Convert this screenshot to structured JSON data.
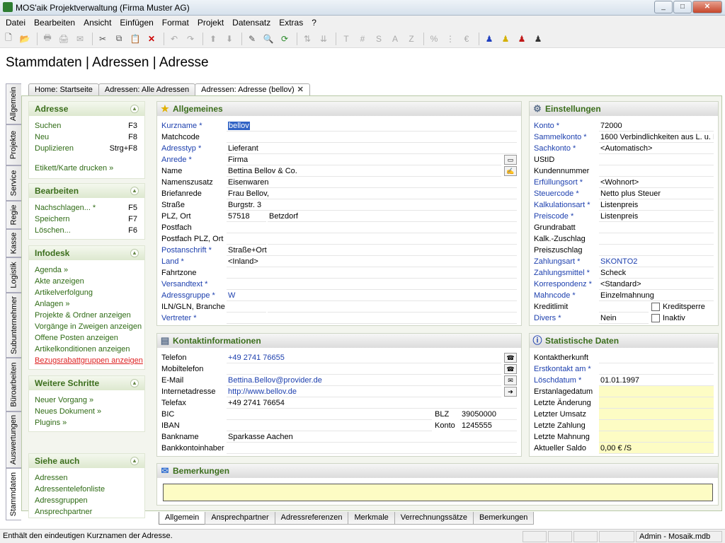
{
  "window": {
    "title": "MOS'aik Projektverwaltung (Firma Muster AG)"
  },
  "menu": [
    "Datei",
    "Bearbeiten",
    "Ansicht",
    "Einfügen",
    "Format",
    "Projekt",
    "Datensatz",
    "Extras",
    "?"
  ],
  "heading": "Stammdaten | Adressen | Adresse",
  "vertical_tabs": [
    "Allgemein",
    "Projekte",
    "Service",
    "Regie",
    "Kasse",
    "Logistik",
    "Subunternehmer",
    "Büroarbeiten",
    "Auswertungen",
    "Stammdaten"
  ],
  "doc_tabs": [
    "Home: Startseite",
    "Adressen: Alle Adressen",
    "Adressen: Adresse (bellov)"
  ],
  "sidebar": {
    "adresse": {
      "title": "Adresse",
      "items": [
        {
          "label": "Suchen",
          "key": "F3"
        },
        {
          "label": "Neu",
          "key": "F8"
        },
        {
          "label": "Duplizieren",
          "key": "Strg+F8"
        }
      ],
      "extra": "Etikett/Karte drucken »"
    },
    "bearbeiten": {
      "title": "Bearbeiten",
      "items": [
        {
          "label": "Nachschlagen... *",
          "key": "F5"
        },
        {
          "label": "Speichern",
          "key": "F7"
        },
        {
          "label": "Löschen...",
          "key": "F6"
        }
      ]
    },
    "infodesk": {
      "title": "Infodesk",
      "items": [
        "Agenda »",
        "Akte anzeigen",
        "Artikelverfolgung",
        "Anlagen »",
        "Projekte & Ordner anzeigen",
        "Vorgänge in Zweigen anzeigen",
        "Offene Posten anzeigen",
        "Artikelkonditionen anzeigen",
        "Bezugsrabattgruppen anzeigen"
      ]
    },
    "weitere": {
      "title": "Weitere Schritte",
      "items": [
        "Neuer Vorgang »",
        "Neues Dokument »",
        "Plugins »"
      ]
    },
    "siehe": {
      "title": "Siehe auch",
      "items": [
        "Adressen",
        "Adressentelefonliste",
        "Adressgruppen",
        "Ansprechpartner"
      ]
    }
  },
  "allgemeines": {
    "title": "Allgemeines",
    "rows": [
      {
        "label": "Kurzname *",
        "value": "bellov"
      },
      {
        "label": "Matchcode",
        "value": ""
      },
      {
        "label": "Adresstyp *",
        "value": "Lieferant"
      },
      {
        "label": "Anrede *",
        "value": "Firma"
      },
      {
        "label": "Name",
        "value": "Bettina Bellov & Co."
      },
      {
        "label": "Namenszusatz",
        "value": "Eisenwaren"
      },
      {
        "label": "Briefanrede",
        "value": " Frau Bellov,"
      },
      {
        "label": "Straße",
        "value": "Burgstr. 3"
      },
      {
        "label": "PLZ, Ort",
        "value": "57518",
        "value2": "Betzdorf"
      },
      {
        "label": "Postfach",
        "value": ""
      },
      {
        "label": "Postfach PLZ, Ort",
        "value": "",
        "value2": ""
      },
      {
        "label": "Postanschrift *",
        "value": "Straße+Ort"
      },
      {
        "label": "Land *",
        "value": "<Inland>"
      },
      {
        "label": "Fahrtzone",
        "value": ""
      },
      {
        "label": "Versandtext *",
        "value": ""
      },
      {
        "label": "Adressgruppe *",
        "value": "W"
      },
      {
        "label": "ILN/GLN, Branche",
        "value": "",
        "value2": ""
      },
      {
        "label": "Vertreter *",
        "value": ""
      }
    ]
  },
  "einstellungen": {
    "title": "Einstellungen",
    "rows": [
      {
        "label": "Konto *",
        "value": "72000"
      },
      {
        "label": "Sammelkonto *",
        "value": "1600 Verbindlichkeiten aus L. u. L"
      },
      {
        "label": "Sachkonto *",
        "value": "<Automatisch>"
      },
      {
        "label": "UStID",
        "value": ""
      },
      {
        "label": "Kundennummer",
        "value": ""
      },
      {
        "label": "Erfüllungsort *",
        "value": "<Wohnort>"
      },
      {
        "label": "Steuercode *",
        "value": "Netto plus Steuer"
      },
      {
        "label": "Kalkulationsart *",
        "value": "Listenpreis"
      },
      {
        "label": "Preiscode *",
        "value": "Listenpreis"
      },
      {
        "label": "Grundrabatt",
        "value": ""
      },
      {
        "label": "Kalk.-Zuschlag",
        "value": ""
      },
      {
        "label": "Preiszuschlag",
        "value": ""
      },
      {
        "label": "Zahlungsart *",
        "value": "SKONTO2"
      },
      {
        "label": "Zahlungsmittel *",
        "value": "Scheck"
      },
      {
        "label": "Korrespondenz *",
        "value": "<Standard>"
      },
      {
        "label": "Mahncode *",
        "value": "Einzelmahnung"
      },
      {
        "label": "Kreditlimit",
        "value": "",
        "check": "Kreditsperre"
      },
      {
        "label": "Divers *",
        "value": "Nein",
        "check": "Inaktiv"
      }
    ]
  },
  "kontakt": {
    "title": "Kontaktinformationen",
    "rows": [
      {
        "label": "Telefon",
        "value": "+49 2741 76655"
      },
      {
        "label": "Mobiltelefon",
        "value": ""
      },
      {
        "label": "E-Mail",
        "value": "Bettina.Bellov@provider.de"
      },
      {
        "label": "Internetadresse",
        "value": "http://www.bellov.de"
      },
      {
        "label": "Telefax",
        "value": "+49 2741 76654"
      },
      {
        "label": "BIC",
        "value": "",
        "sublabel": "BLZ",
        "subvalue": "39050000"
      },
      {
        "label": "IBAN",
        "value": "",
        "sublabel": "Konto",
        "subvalue": "1245555"
      },
      {
        "label": "Bankname",
        "value": "Sparkasse Aachen"
      },
      {
        "label": "Bankkontoinhaber",
        "value": ""
      }
    ]
  },
  "statistik": {
    "title": "Statistische Daten",
    "rows": [
      {
        "label": "Kontaktherkunft",
        "value": ""
      },
      {
        "label": "Erstkontakt am *",
        "value": ""
      },
      {
        "label": "Löschdatum *",
        "value": "01.01.1997"
      },
      {
        "label": "Erstanlagedatum",
        "value": ""
      },
      {
        "label": "Letzte Änderung",
        "value": ""
      },
      {
        "label": "Letzter Umsatz",
        "value": ""
      },
      {
        "label": "Letzte Zahlung",
        "value": ""
      },
      {
        "label": "Letzte Mahnung",
        "value": ""
      },
      {
        "label": "Aktueller Saldo",
        "value": "0,00 € /S"
      }
    ]
  },
  "bemerkungen": {
    "title": "Bemerkungen",
    "value": ""
  },
  "bottom_tabs": [
    "Allgemein",
    "Ansprechpartner",
    "Adressreferenzen",
    "Merkmale",
    "Verrechnungssätze",
    "Bemerkungen"
  ],
  "status": {
    "message": "Enthält den eindeutigen Kurznamen der Adresse.",
    "user": "Admin - Mosaik.mdb"
  },
  "colors": {
    "accent_green": "#3b6e1c",
    "link_blue": "#1c3fae",
    "highlight_yellow": "#fdfcc4",
    "selection": "#3163c5"
  }
}
